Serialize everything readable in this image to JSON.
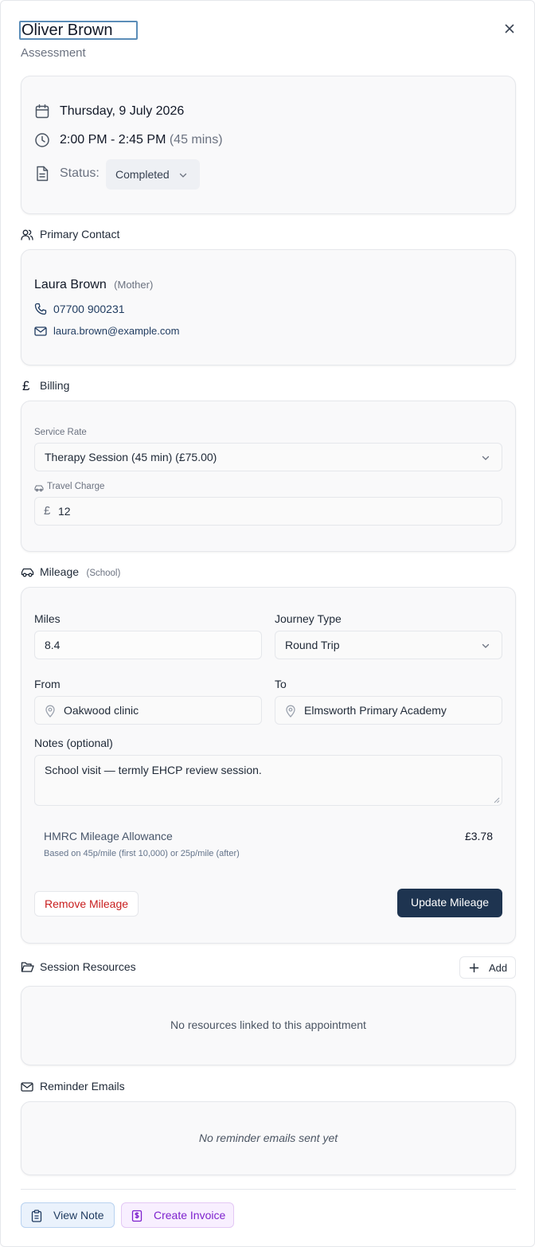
{
  "header": {
    "title": "Oliver Brown",
    "subtitle": "Assessment"
  },
  "appointment": {
    "date": "Thursday, 9 July 2026",
    "time": "2:00 PM - 2:45 PM",
    "duration": "(45 mins)",
    "status_label": "Status:",
    "status_value": "Completed"
  },
  "primary_contact": {
    "section_title": "Primary Contact",
    "name": "Laura Brown",
    "relationship": "(Mother)",
    "phone": "07700 900231",
    "email": "laura.brown@example.com"
  },
  "billing": {
    "section_title": "Billing",
    "service_rate_label": "Service Rate",
    "service_rate_value": "Therapy Session (45 min) (£75.00)",
    "travel_charge_label": "Travel Charge",
    "currency_symbol": "£",
    "travel_charge_value": "12"
  },
  "mileage": {
    "section_title": "Mileage",
    "section_tag": "(School)",
    "miles_label": "Miles",
    "miles_value": "8.4",
    "journey_type_label": "Journey Type",
    "journey_type_value": "Round Trip",
    "from_label": "From",
    "from_value": "Oakwood clinic",
    "to_label": "To",
    "to_value": "Elmsworth Primary Academy",
    "notes_label": "Notes (optional)",
    "notes_value": "School visit — termly EHCP review session.",
    "allowance_title": "HMRC Mileage Allowance",
    "allowance_amount": "£3.78",
    "allowance_note": "Based on 45p/mile (first 10,000) or 25p/mile (after)",
    "remove_label": "Remove Mileage",
    "update_label": "Update Mileage"
  },
  "resources": {
    "section_title": "Session Resources",
    "add_label": "Add",
    "empty_text": "No resources linked to this appointment"
  },
  "reminders": {
    "section_title": "Reminder Emails",
    "empty_text": "No reminder emails sent yet"
  },
  "footer": {
    "view_note_label": "View Note",
    "create_invoice_label": "Create Invoice"
  },
  "colors": {
    "primary_button": "#1e3450",
    "danger_text": "#c81e1e",
    "invoice_purple": "#7e22ce",
    "link_navy": "#1e3a5f"
  }
}
